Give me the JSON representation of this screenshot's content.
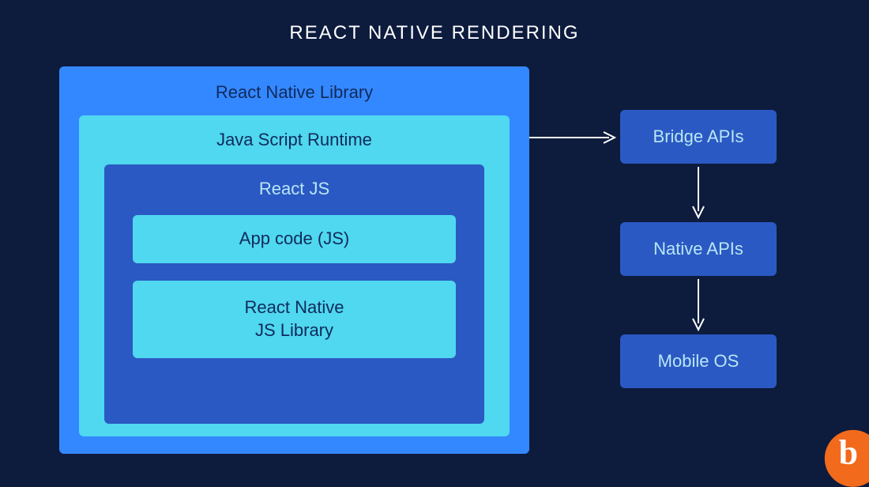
{
  "title": "REACT NATIVE RENDERING",
  "outer": {
    "label": "React Native Library",
    "runtime": {
      "label": "Java Script Runtime",
      "reactjs": {
        "label": "React JS",
        "items": [
          "App code (JS)",
          "React Native\nJS Library"
        ]
      }
    }
  },
  "flow": [
    "Bridge APIs",
    "Native APIs",
    "Mobile OS"
  ],
  "logo_glyph": "b",
  "colors": {
    "bg": "#0d1b3d",
    "blue_bright": "#3488ff",
    "cyan": "#4fd8ef",
    "blue_deep": "#2b59c3",
    "text_dark": "#102a5c",
    "text_light": "#b8e6f5",
    "orange": "#f26a1b"
  }
}
